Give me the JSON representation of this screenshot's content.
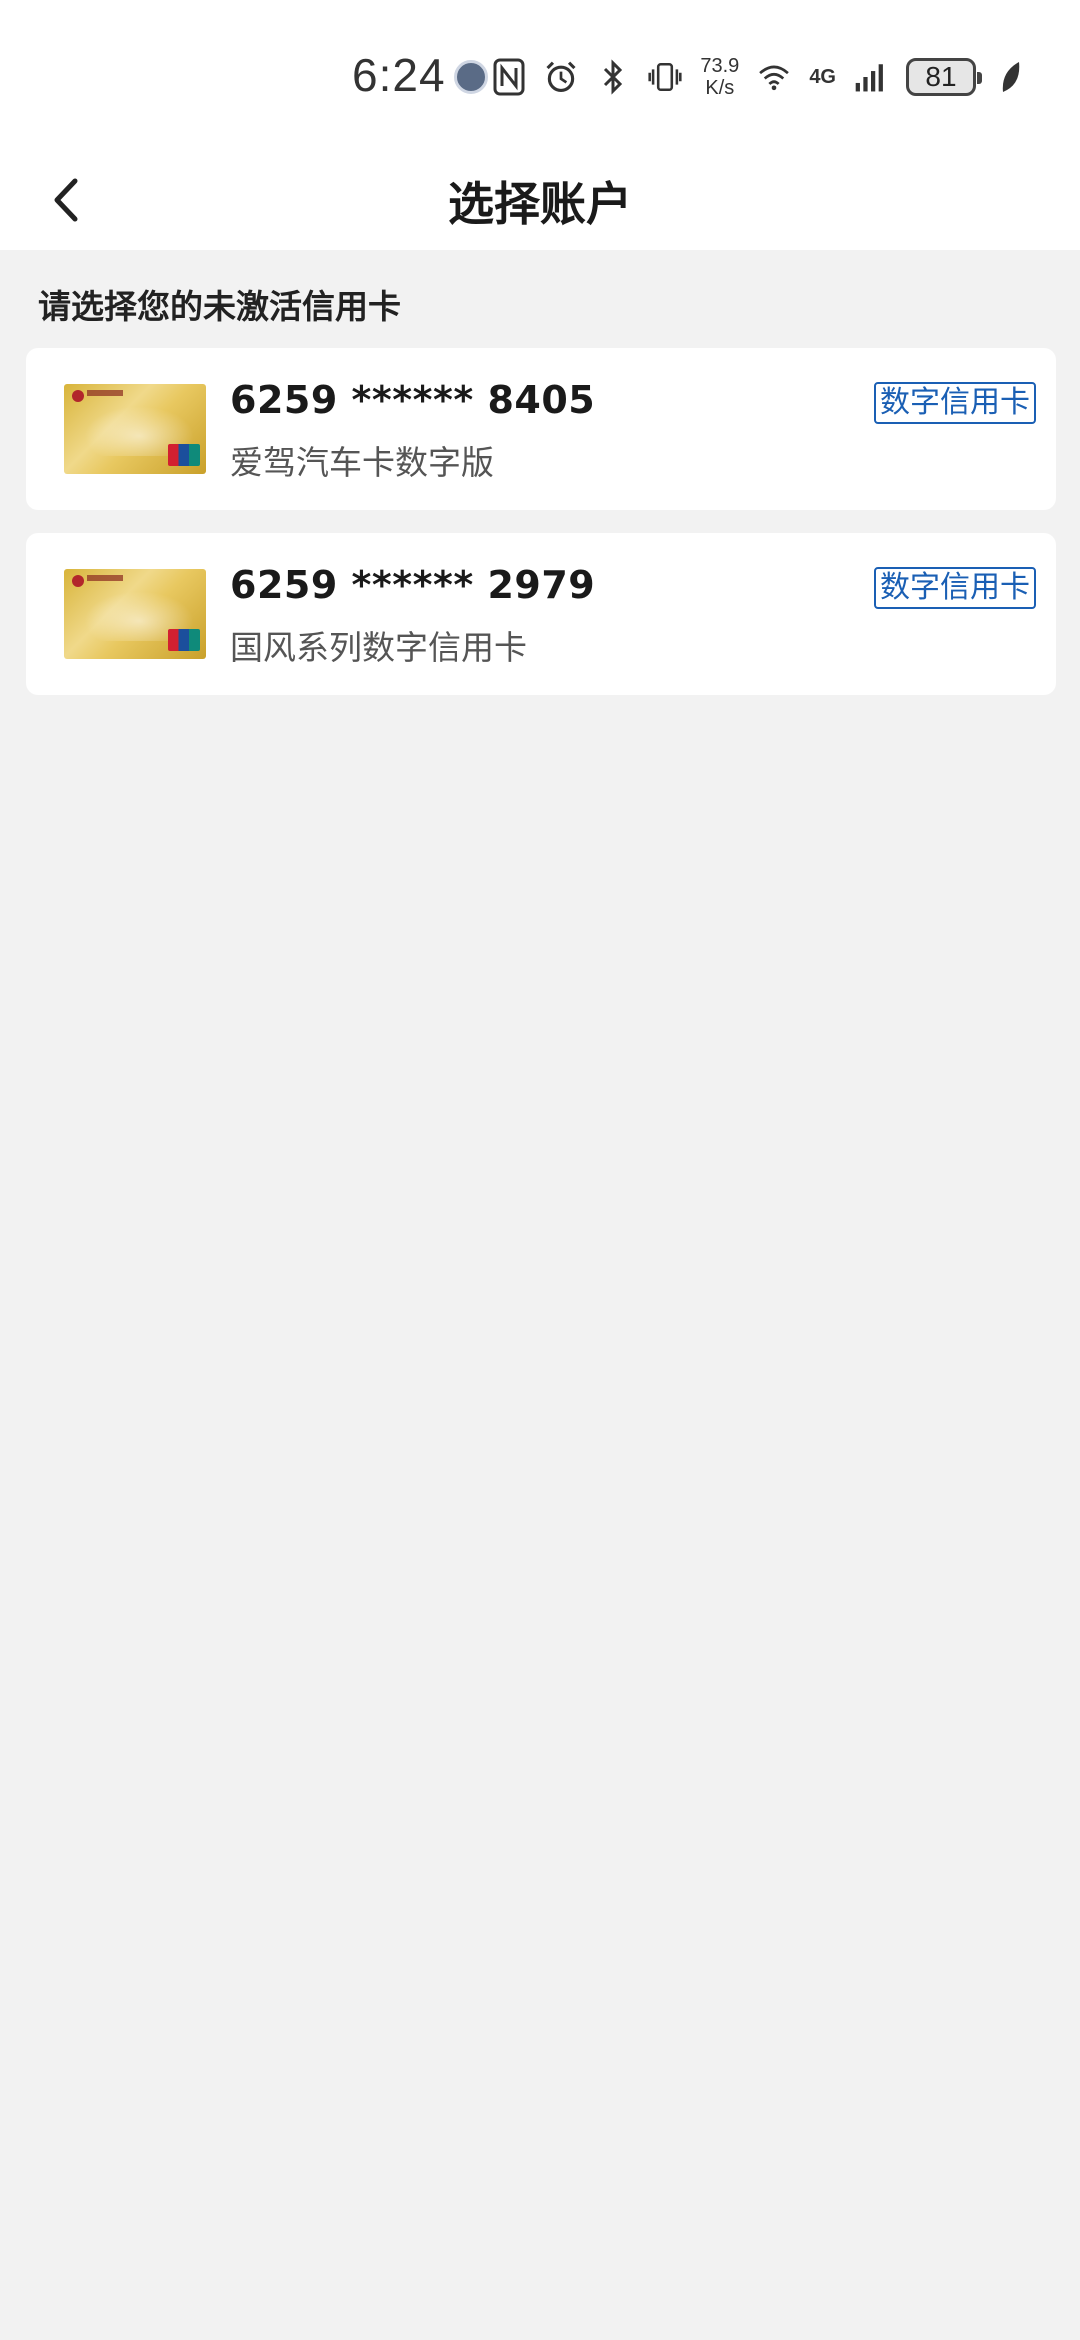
{
  "status_bar": {
    "time": "6:24",
    "net_speed_value": "73.9",
    "net_speed_unit": "K/s",
    "network_type": "4G",
    "battery_level": "81",
    "icons": [
      "nfc-icon",
      "alarm-icon",
      "bluetooth-icon",
      "vibrate-icon",
      "wifi-icon",
      "signal-icon",
      "battery-icon",
      "leaf-icon"
    ]
  },
  "navbar": {
    "title": "选择账户"
  },
  "section": {
    "title": "请选择您的未激活信用卡"
  },
  "cards": [
    {
      "number": "6259 ****** 8405",
      "name": "爱驾汽车卡数字版",
      "tag": "数字信用卡"
    },
    {
      "number": "6259 ****** 2979",
      "name": "国风系列数字信用卡",
      "tag": "数字信用卡"
    }
  ],
  "colors": {
    "tag_blue": "#1a5fb4",
    "background": "#f2f2f2",
    "card_gold": "#d8b43a"
  }
}
